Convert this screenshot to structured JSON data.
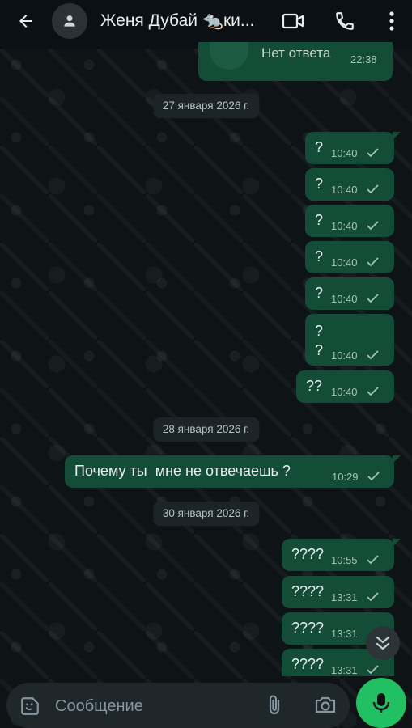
{
  "header": {
    "title": "Женя Дубай 🐀ки...",
    "icons": [
      "back-arrow-icon",
      "avatar-icon",
      "video-call-icon",
      "phone-icon",
      "more-vert-icon"
    ]
  },
  "messages": [
    {
      "text": "Нет ответа",
      "time": "22:38",
      "status": "sent"
    },
    {
      "date": "27 января 2026 г."
    },
    {
      "text": "?",
      "time": "10:40",
      "status": "sent"
    },
    {
      "text": "?",
      "time": "10:40",
      "status": "sent"
    },
    {
      "text": "?",
      "time": "10:40",
      "status": "sent"
    },
    {
      "text": "?",
      "time": "10:40",
      "status": "sent"
    },
    {
      "text": "?",
      "time": "10:40",
      "status": "sent"
    },
    {
      "text": "?\n?",
      "time": "10:40",
      "status": "sent"
    },
    {
      "text": "??",
      "time": "10:40",
      "status": "sent"
    },
    {
      "date": "28 января 2026 г."
    },
    {
      "text": "Почему ты  мне не отвечаешь ?",
      "time": "10:29",
      "status": "sent"
    },
    {
      "date": "30 января 2026 г."
    },
    {
      "text": "????",
      "time": "10:55",
      "status": "sent"
    },
    {
      "text": "????",
      "time": "13:31",
      "status": "sent"
    },
    {
      "text": "????",
      "time": "13:31",
      "status": "sent"
    },
    {
      "text": "????",
      "time": "13:31",
      "status": "sent"
    }
  ],
  "composer": {
    "placeholder": "Сообщение"
  },
  "colors": {
    "outgoing_bubble": "#134d37",
    "background": "#0b1014",
    "mic_button": "#21c063"
  }
}
